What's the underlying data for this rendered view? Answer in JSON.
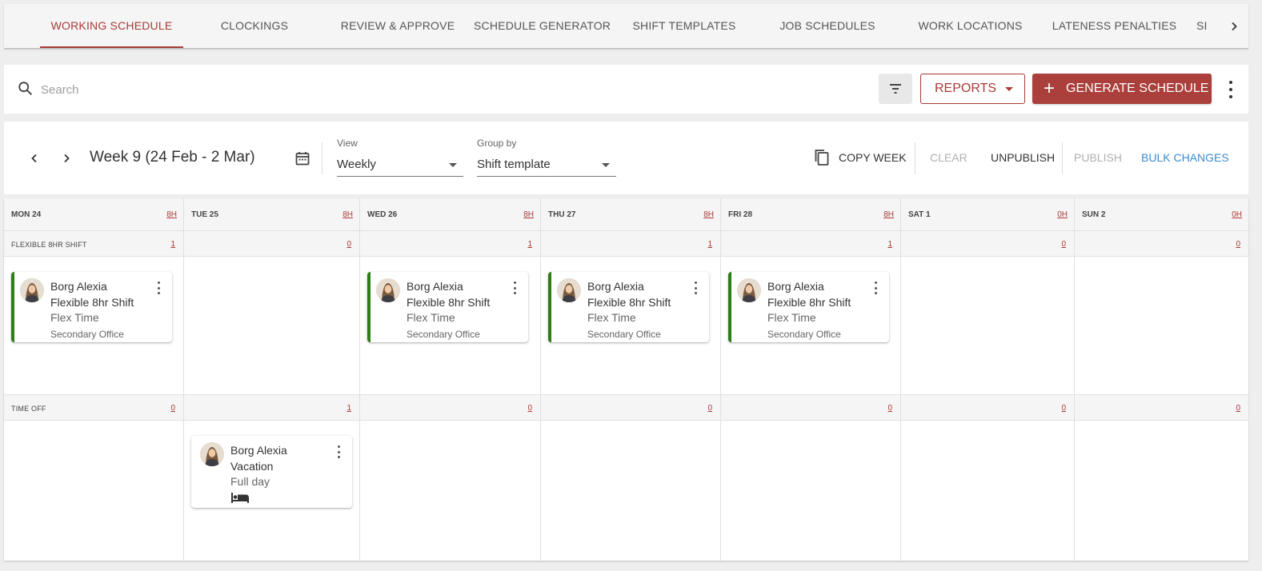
{
  "tabs": [
    {
      "label": "Working Schedule",
      "active": true
    },
    {
      "label": "Clockings"
    },
    {
      "label": "Review & Approve"
    },
    {
      "label": "Schedule Generator"
    },
    {
      "label": "Shift Templates"
    },
    {
      "label": "Job Schedules"
    },
    {
      "label": "Work Locations"
    },
    {
      "label": "Lateness Penalties"
    },
    {
      "label": "SI"
    }
  ],
  "search": {
    "placeholder": "Search",
    "value": ""
  },
  "toolbar": {
    "reports_label": "Reports",
    "generate_label": "Generate Schedule"
  },
  "week": {
    "title": "Week 9 (24 Feb - 2 Mar)",
    "view_label": "View",
    "view_value": "Weekly",
    "group_label": "Group by",
    "group_value": "Shift template",
    "copy_week": "Copy Week",
    "clear": "Clear",
    "unpublish": "Unpublish",
    "publish": "Publish",
    "bulk_changes": "Bulk Changes"
  },
  "colors": {
    "accent": "#ab3f3b",
    "shift_bar": "#2e7d16",
    "link": "#3a8bd0"
  },
  "days": [
    {
      "label": "Mon 24",
      "hours": "8H",
      "flex_count": "1",
      "off_count": "0"
    },
    {
      "label": "Tue 25",
      "hours": "8H",
      "flex_count": "0",
      "off_count": "1"
    },
    {
      "label": "Wed 26",
      "hours": "8H",
      "flex_count": "1",
      "off_count": "0"
    },
    {
      "label": "Thu 27",
      "hours": "8H",
      "flex_count": "1",
      "off_count": "0"
    },
    {
      "label": "Fri 28",
      "hours": "8H",
      "flex_count": "1",
      "off_count": "0"
    },
    {
      "label": "Sat 1",
      "hours": "0H",
      "flex_count": "0",
      "off_count": "0"
    },
    {
      "label": "Sun 2",
      "hours": "0H",
      "flex_count": "0",
      "off_count": "0"
    }
  ],
  "groups": {
    "flex": "Flexible 8hr shift",
    "off": "Time Off"
  },
  "shift_card": {
    "name": "Borg Alexia",
    "type": "Flexible 8hr Shift",
    "sub": "Flex Time",
    "location": "Secondary Office"
  },
  "off_card": {
    "name": "Borg Alexia",
    "type": "Vacation",
    "sub": "Full day",
    "icon": "bed-icon"
  }
}
